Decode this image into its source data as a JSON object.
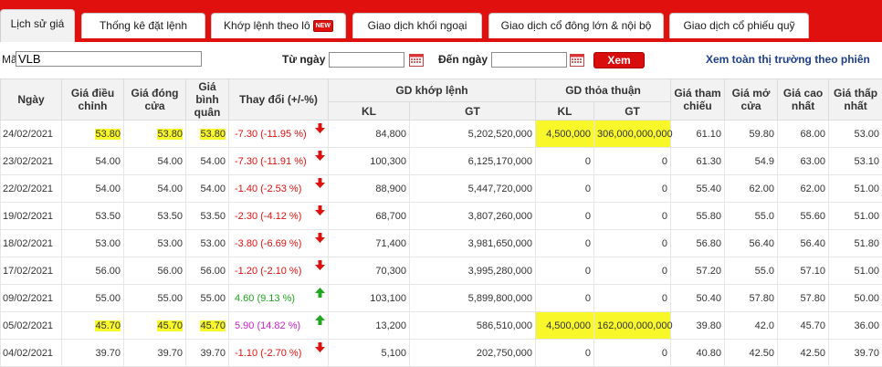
{
  "tabs": [
    {
      "label": "Lịch sử giá",
      "active": true
    },
    {
      "label": "Thống kê đặt lệnh",
      "active": false
    },
    {
      "label": "Khớp lệnh theo lô",
      "active": false,
      "badge": "NEW"
    },
    {
      "label": "Giao dịch khối ngoại",
      "active": false
    },
    {
      "label": "Giao dịch cổ đông lớn & nội bộ",
      "active": false
    },
    {
      "label": "Giao dịch cổ phiếu quỹ",
      "active": false
    }
  ],
  "search": {
    "ticker_label": "Mã",
    "ticker_value": "VLB",
    "from_label": "Từ ngày",
    "from_value": "",
    "to_label": "Đến ngày",
    "to_value": "",
    "view_button": "Xem",
    "all_market_link": "Xem toàn thị trường theo phiên"
  },
  "table": {
    "headers": {
      "date": "Ngày",
      "adj": "Giá điều chỉnh",
      "close": "Giá đóng cửa",
      "avg": "Giá bình quân",
      "change": "Thay đổi (+/-%)",
      "matched": "GD khớp lệnh",
      "negotiated": "GD thỏa thuận",
      "kl": "KL",
      "gt": "GT",
      "ref": "Giá tham chiếu",
      "open": "Giá mở cửa",
      "high": "Giá cao nhất",
      "low": "Giá thấp nhất"
    },
    "rows": [
      {
        "date": "24/02/2021",
        "adj": "53.80",
        "close": "53.80",
        "avg": "53.80",
        "change": "-7.30 (-11.95 %)",
        "dir": "down",
        "m_kl": "84,800",
        "m_gt": "5,202,520,000",
        "n_kl": "4,500,000",
        "n_gt": "306,000,000,000",
        "ref": "61.10",
        "open": "59.80",
        "high": "68.00",
        "low": "53.00",
        "hl_prices": true,
        "hl_neg": true
      },
      {
        "date": "23/02/2021",
        "adj": "54.00",
        "close": "54.00",
        "avg": "54.00",
        "change": "-7.30 (-11.91 %)",
        "dir": "down",
        "m_kl": "100,300",
        "m_gt": "6,125,170,000",
        "n_kl": "0",
        "n_gt": "0",
        "ref": "61.30",
        "open": "54.9",
        "high": "63.00",
        "low": "53.10",
        "hl_prices": false,
        "hl_neg": false
      },
      {
        "date": "22/02/2021",
        "adj": "54.00",
        "close": "54.00",
        "avg": "54.00",
        "change": "-1.40 (-2.53 %)",
        "dir": "down",
        "m_kl": "88,900",
        "m_gt": "5,447,720,000",
        "n_kl": "0",
        "n_gt": "0",
        "ref": "55.40",
        "open": "62.00",
        "high": "62.00",
        "low": "51.00",
        "hl_prices": false,
        "hl_neg": false
      },
      {
        "date": "19/02/2021",
        "adj": "53.50",
        "close": "53.50",
        "avg": "53.50",
        "change": "-2.30 (-4.12 %)",
        "dir": "down",
        "m_kl": "68,700",
        "m_gt": "3,807,260,000",
        "n_kl": "0",
        "n_gt": "0",
        "ref": "55.80",
        "open": "55.0",
        "high": "55.60",
        "low": "51.00",
        "hl_prices": false,
        "hl_neg": false
      },
      {
        "date": "18/02/2021",
        "adj": "53.00",
        "close": "53.00",
        "avg": "53.00",
        "change": "-3.80 (-6.69 %)",
        "dir": "down",
        "m_kl": "71,400",
        "m_gt": "3,981,650,000",
        "n_kl": "0",
        "n_gt": "0",
        "ref": "56.80",
        "open": "56.40",
        "high": "56.40",
        "low": "51.80",
        "hl_prices": false,
        "hl_neg": false
      },
      {
        "date": "17/02/2021",
        "adj": "56.00",
        "close": "56.00",
        "avg": "56.00",
        "change": "-1.20 (-2.10 %)",
        "dir": "down",
        "m_kl": "70,300",
        "m_gt": "3,995,280,000",
        "n_kl": "0",
        "n_gt": "0",
        "ref": "57.20",
        "open": "55.0",
        "high": "57.10",
        "low": "51.00",
        "hl_prices": false,
        "hl_neg": false
      },
      {
        "date": "09/02/2021",
        "adj": "55.00",
        "close": "55.00",
        "avg": "55.00",
        "change": "4.60 (9.13 %)",
        "dir": "up",
        "m_kl": "103,100",
        "m_gt": "5,899,800,000",
        "n_kl": "0",
        "n_gt": "0",
        "ref": "50.40",
        "open": "57.80",
        "high": "57.80",
        "low": "50.00",
        "hl_prices": false,
        "hl_neg": false
      },
      {
        "date": "05/02/2021",
        "adj": "45.70",
        "close": "45.70",
        "avg": "45.70",
        "change": "5.90 (14.82 %)",
        "dir": "ceil",
        "m_kl": "13,200",
        "m_gt": "586,510,000",
        "n_kl": "4,500,000",
        "n_gt": "162,000,000,000",
        "ref": "39.80",
        "open": "42.0",
        "high": "45.70",
        "low": "36.00",
        "hl_prices": true,
        "hl_neg": true
      },
      {
        "date": "04/02/2021",
        "adj": "39.70",
        "close": "39.70",
        "avg": "39.70",
        "change": "-1.10 (-2.70 %)",
        "dir": "down",
        "m_kl": "5,100",
        "m_gt": "202,750,000",
        "n_kl": "0",
        "n_gt": "0",
        "ref": "40.80",
        "open": "42.50",
        "high": "42.50",
        "low": "39.70",
        "hl_prices": false,
        "hl_neg": false
      }
    ]
  },
  "colors": {
    "brand_red": "#e0100e",
    "up": "#1ea81e",
    "down": "#e0100e",
    "ceiling": "#cc22cc",
    "highlight": "#f7f72a"
  }
}
